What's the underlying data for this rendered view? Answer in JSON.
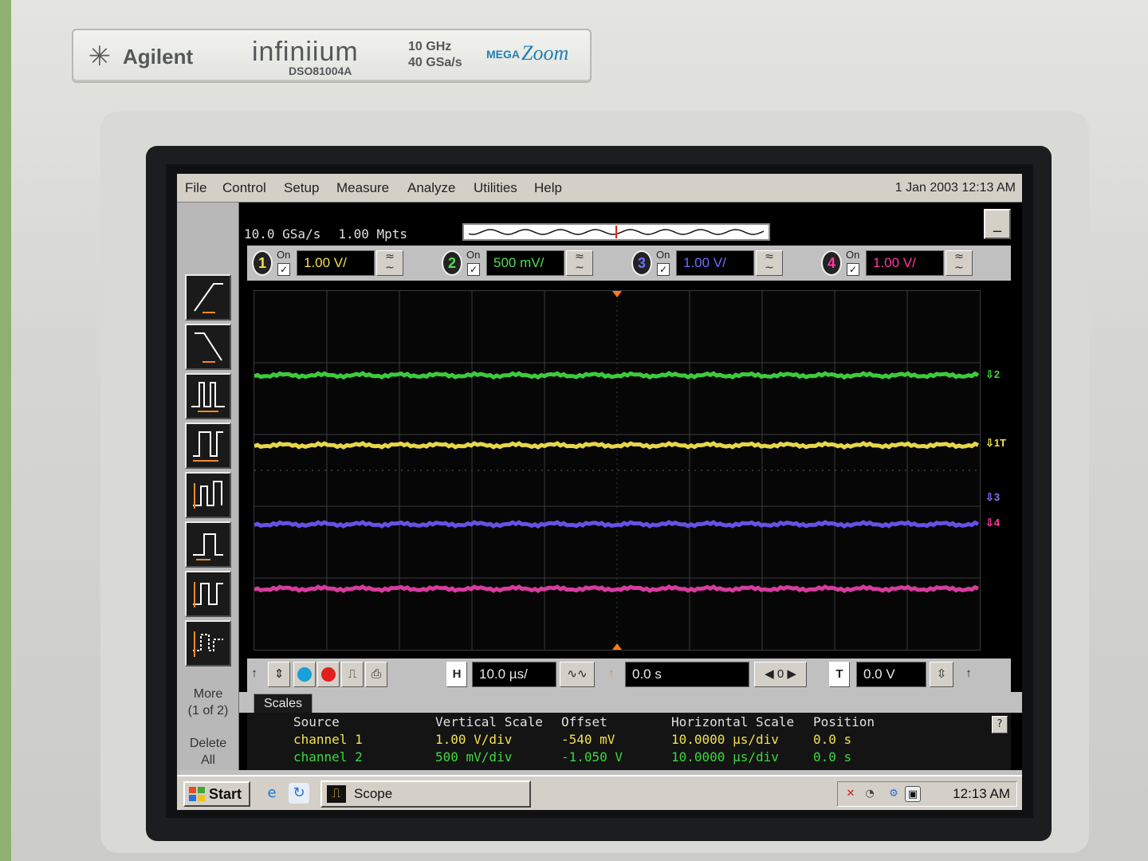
{
  "instrument": {
    "brand": "Agilent",
    "model": "infiniium",
    "model_number": "DSO81004A",
    "bandwidth": "10 GHz",
    "sample_rate_spec": "40 GSa/s",
    "megazoom_prefix": "MEGA",
    "megazoom_suffix": "Zoom"
  },
  "menubar": {
    "items": [
      "File",
      "Control",
      "Setup",
      "Measure",
      "Analyze",
      "Utilities",
      "Help"
    ],
    "datetime": "1 Jan 2003 12:13 AM"
  },
  "acquisition": {
    "sample_rate": "10.0 GSa/s",
    "memory_depth": "1.00 Mpts",
    "minimize_label": "_"
  },
  "channels": [
    {
      "number": "1",
      "on_label": "On",
      "scale": "1.00 V/",
      "color": "#f5e04a"
    },
    {
      "number": "2",
      "on_label": "On",
      "scale": "500 mV/",
      "color": "#4ee04e"
    },
    {
      "number": "3",
      "on_label": "On",
      "scale": "1.00 V/",
      "color": "#6e6eff"
    },
    {
      "number": "4",
      "on_label": "On",
      "scale": "1.00 V/",
      "color": "#ff3aa0"
    }
  ],
  "waveform_colors": {
    "ch1": "#f2e24e",
    "ch2": "#3fd63f",
    "ch3": "#6a55f0",
    "ch4": "#e23fa6",
    "grid": "#3b3b3b",
    "trigger_marker": "#ff7a1a"
  },
  "markers": [
    {
      "label": "2",
      "color": "#3fd63f"
    },
    {
      "label": "1T",
      "color": "#f2e24e"
    },
    {
      "label": "3",
      "color": "#8a70ff"
    },
    {
      "label": "4",
      "color": "#ff3aa0"
    }
  ],
  "side_buttons": {
    "more_line1": "More",
    "more_line2": "(1 of 2)",
    "delete_line1": "Delete",
    "delete_line2": "All"
  },
  "controls": {
    "horizontal_label": "H",
    "horizontal_scale": "10.0 µs/",
    "delay": "0.0 s",
    "delay_ref": "0",
    "trigger_label": "T",
    "trigger_level": "0.0 V"
  },
  "scales_tab": {
    "tab_label": "Scales",
    "headers": [
      "Source",
      "Vertical Scale",
      "Offset",
      "Horizontal Scale",
      "Position"
    ],
    "rows": [
      {
        "source": "channel 1",
        "vertical_scale": "1.00 V/div",
        "offset": "-540 mV",
        "horizontal_scale": "10.0000 µs/div",
        "position": "0.0 s",
        "color": "#f2e24e"
      },
      {
        "source": "channel 2",
        "vertical_scale": "500 mV/div",
        "offset": "-1.050 V",
        "horizontal_scale": "10.0000 µs/div",
        "position": "0.0 s",
        "color": "#3fd63f"
      }
    ],
    "help_label": "?"
  },
  "taskbar": {
    "start_label": "Start",
    "scope_label": "Scope",
    "clock": "12:13 AM"
  }
}
